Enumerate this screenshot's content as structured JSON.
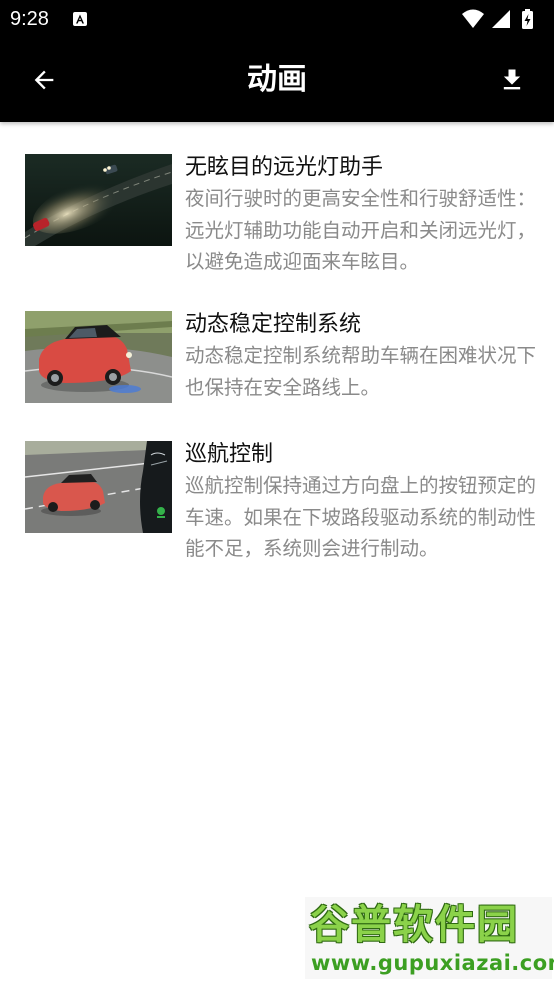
{
  "status_bar": {
    "time": "9:28"
  },
  "app_bar": {
    "title": "动画",
    "back_icon": "arrow-back-icon",
    "download_icon": "download-icon"
  },
  "items": [
    {
      "title": "无眩目的远光灯助手",
      "description": "夜间行驶时的更高安全性和行驶舒适性：远光灯辅助功能自动开启和关闭远光灯，以避免造成迎面来车眩目。",
      "thumbnail": "night-high-beam-thumbnail"
    },
    {
      "title": "动态稳定控制系统",
      "description": "动态稳定控制系统帮助车辆在困难状况下也保持在安全路线上。",
      "thumbnail": "red-car-stability-thumbnail"
    },
    {
      "title": "巡航控制",
      "description": "巡航控制保持通过方向盘上的按钮预定的车速。如果在下坡路段驱动系统的制动性能不足，系统则会进行制动。",
      "thumbnail": "cruise-control-thumbnail"
    }
  ],
  "watermark": {
    "logo": "谷普软件园",
    "url": "www.gupuxiazai.com"
  }
}
